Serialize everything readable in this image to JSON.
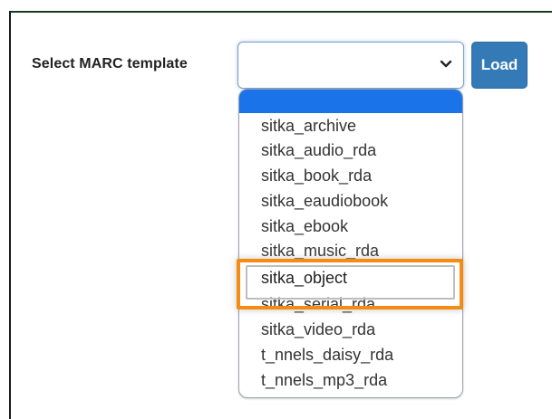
{
  "form": {
    "label": "Select MARC template",
    "select_value": "",
    "load_button": "Load"
  },
  "dropdown": {
    "options": [
      "sitka_archive",
      "sitka_audio_rda",
      "sitka_book_rda",
      "sitka_eaudiobook",
      "sitka_ebook",
      "sitka_music_rda",
      "sitka_object",
      "sitka_serial_rda",
      "sitka_video_rda",
      "t_nnels_daisy_rda",
      "t_nnels_mp3_rda"
    ],
    "selected_index": 0
  },
  "icons": {
    "select_chevron": "chevron-down-icon"
  },
  "colors": {
    "dropdown_selected": "#1a73e8",
    "button": "#337ab7",
    "highlight": "#f58b12",
    "border": "#1b3a22"
  }
}
